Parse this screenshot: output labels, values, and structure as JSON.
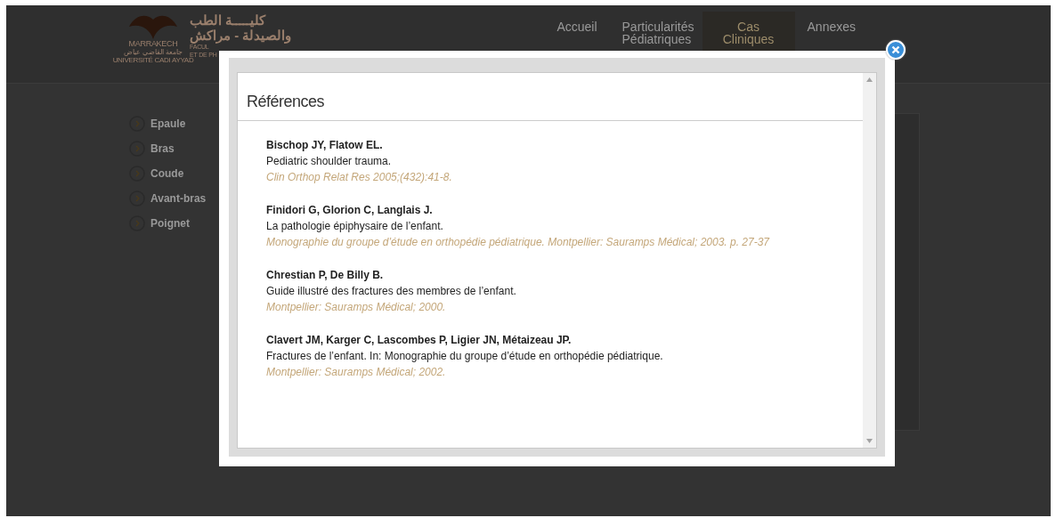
{
  "header": {
    "logo": {
      "city": "MARRAKECH",
      "arabic_university": "جامعة القاضي عياض",
      "university": "UNIVERSITÉ CADI AYYAD"
    },
    "faculty_arabic": [
      "كليـــــة الطب",
      "والصيدلة - مراكش"
    ],
    "faculty_french": [
      "FACUL",
      "ET DE PH"
    ],
    "nav": [
      {
        "label": "Accueil",
        "selected": false
      },
      {
        "label": "Particularités Pédiatriques",
        "selected": false
      },
      {
        "label": "Cas Cliniques",
        "selected": true
      },
      {
        "label": "Annexes",
        "selected": false
      }
    ]
  },
  "sidebar": {
    "items": [
      {
        "label": "Epaule"
      },
      {
        "label": "Bras"
      },
      {
        "label": "Coude"
      },
      {
        "label": "Avant-bras"
      },
      {
        "label": "Poignet"
      }
    ]
  },
  "modal": {
    "title": "Références",
    "references": [
      {
        "authors": "Bischop JY, Flatow EL.",
        "title": "Pediatric shoulder trauma.",
        "source": "Clin Orthop Relat Res 2005;(432):41-8."
      },
      {
        "authors": "Finidori G, Glorion C, Langlais J.",
        "title": "La pathologie épiphysaire de l’enfant.",
        "source": "Monographie du groupe d’étude en orthopédie pédiatrique. Montpellier: Sauramps Médical; 2003. p. 27-37"
      },
      {
        "authors": "Chrestian P, De Billy B.",
        "title": "Guide illustré des fractures des membres de l’enfant.",
        "source": "Montpellier: Sauramps Médical; 2000."
      },
      {
        "authors": "Clavert JM, Karger C, Lascombes P, Ligier JN, Métaizeau JP.",
        "title": "Fractures de l’enfant. In: Monographie du groupe d’étude en orthopédie pédiatrique.",
        "source": "Montpellier: Sauramps Médical; 2002."
      }
    ]
  }
}
